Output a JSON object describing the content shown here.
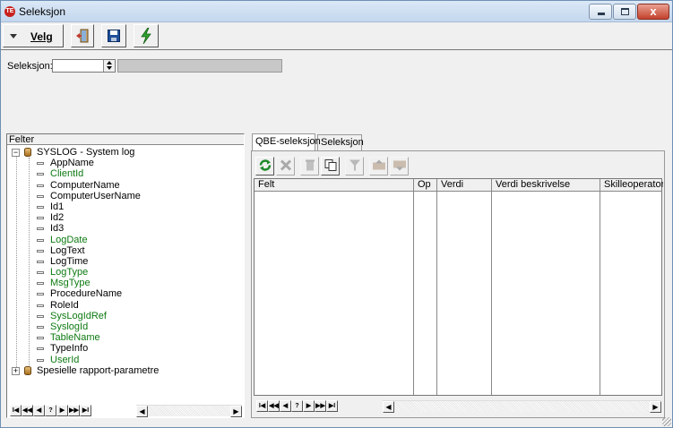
{
  "window": {
    "title": "Seleksjon",
    "app_icon_text": "TE",
    "close_glyph": "x"
  },
  "toolbar": {
    "velg_label": "Velg",
    "exit_icon": "exit-door-icon",
    "save_icon": "floppy-disk-icon",
    "run_icon": "lightning-bolt-icon"
  },
  "selection": {
    "label": "Seleksjon:",
    "value": "",
    "description": ""
  },
  "tree": {
    "header": "Felter",
    "root": {
      "label": "SYSLOG - System log",
      "expander": "−",
      "fields": [
        {
          "label": "AppName",
          "required": false
        },
        {
          "label": "ClientId",
          "required": true
        },
        {
          "label": "ComputerName",
          "required": false
        },
        {
          "label": "ComputerUserName",
          "required": false
        },
        {
          "label": "Id1",
          "required": false
        },
        {
          "label": "Id2",
          "required": false
        },
        {
          "label": "Id3",
          "required": false
        },
        {
          "label": "LogDate",
          "required": true
        },
        {
          "label": "LogText",
          "required": false
        },
        {
          "label": "LogTime",
          "required": false
        },
        {
          "label": "LogType",
          "required": true
        },
        {
          "label": "MsgType",
          "required": true
        },
        {
          "label": "ProcedureName",
          "required": false
        },
        {
          "label": "RoleId",
          "required": false
        },
        {
          "label": "SysLogIdRef",
          "required": true
        },
        {
          "label": "SyslogId",
          "required": true
        },
        {
          "label": "TableName",
          "required": true
        },
        {
          "label": "TypeInfo",
          "required": false
        },
        {
          "label": "UserId",
          "required": true
        }
      ]
    },
    "second": {
      "label": "Spesielle rapport-parametre",
      "expander": "+"
    }
  },
  "nav_buttons": [
    "I◀",
    "◀◀",
    "◀",
    "?",
    "▶",
    "▶▶",
    "▶I"
  ],
  "scroll": {
    "left": "◀",
    "right": "▶"
  },
  "tabs": [
    {
      "label": "QBE-seleksjon",
      "active": true
    },
    {
      "label": "Seleksjon",
      "active": false
    }
  ],
  "qbe_toolbar": [
    {
      "icon": "refresh-icon",
      "enabled": true
    },
    {
      "icon": "delete-x-icon",
      "enabled": false
    },
    {
      "icon": "trash-icon",
      "enabled": false
    },
    {
      "icon": "copy-icon",
      "enabled": true
    },
    {
      "icon": "filter-icon",
      "enabled": false
    },
    {
      "icon": "move-up-icon",
      "enabled": false
    },
    {
      "icon": "move-down-icon",
      "enabled": false
    }
  ],
  "grid": {
    "columns": [
      "Felt",
      "Op",
      "Verdi",
      "Verdi beskrivelse",
      "Skilleoperator"
    ],
    "rows": []
  },
  "colors": {
    "required_field": "#0e7a12",
    "title_bar": "#c4d7ee"
  }
}
